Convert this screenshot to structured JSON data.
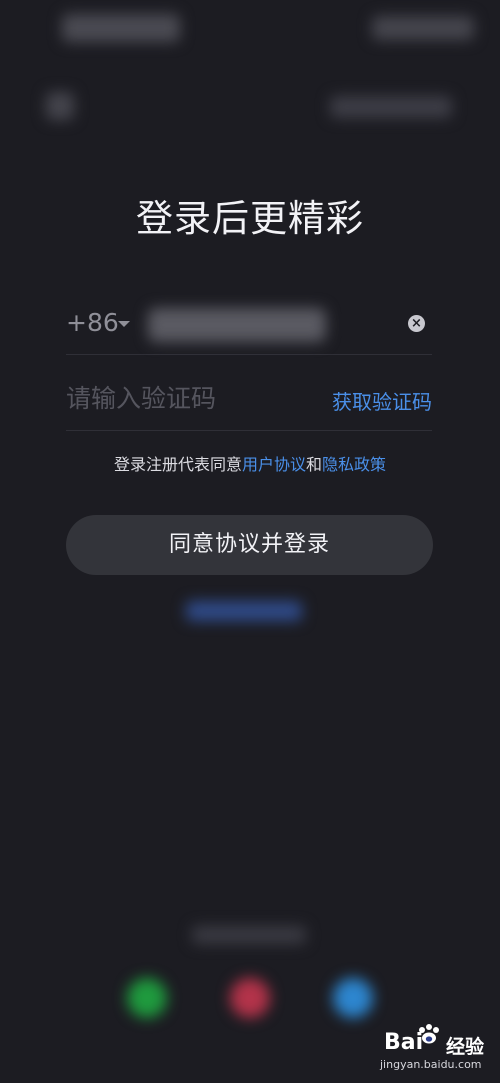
{
  "header": {
    "title": "登录后更精彩"
  },
  "phone": {
    "country_code": "+86"
  },
  "verification": {
    "placeholder": "请输入验证码",
    "get_code_label": "获取验证码"
  },
  "agreement": {
    "prefix": "登录注册代表同意",
    "user_agreement": "用户协议",
    "conjunction": "和",
    "privacy_policy": "隐私政策"
  },
  "login_button": {
    "label": "同意协议并登录"
  },
  "watermark": {
    "brand": "Bai",
    "brand_suffix": "经验",
    "url": "jingyan.baidu.com"
  },
  "icons": {
    "clear": "clear-icon",
    "caret": "chevron-down-icon",
    "back": "back-icon"
  },
  "colors": {
    "background": "#1c1c22",
    "link": "#4a8fe8",
    "button": "#33343a",
    "wechat": "#1f9a3e",
    "weibo": "#b3334a",
    "qq": "#2d86cf"
  }
}
